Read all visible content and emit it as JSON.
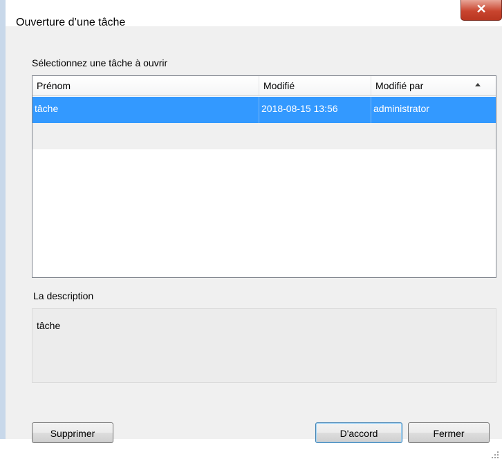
{
  "window": {
    "title": "Ouverture d’une tâche",
    "close_glyph": "✕"
  },
  "task_list": {
    "label": "Sélectionnez une tâche à ouvrir",
    "columns": [
      "Prénom",
      "Modifié",
      "Modifié par"
    ],
    "sort_icon": "sort-ascending-icon",
    "rows": [
      {
        "name": "tâche",
        "modified": "2018-08-15 13:56",
        "modified_by": "administrator",
        "selected": true
      }
    ]
  },
  "description": {
    "label": "La description",
    "value": "tâche"
  },
  "buttons": {
    "delete": "Supprimer",
    "ok": "D'accord",
    "close": "Fermer"
  },
  "colors": {
    "selection": "#3399ff",
    "close_button": "#c9452f",
    "window_frame": "#c8d8ea"
  }
}
